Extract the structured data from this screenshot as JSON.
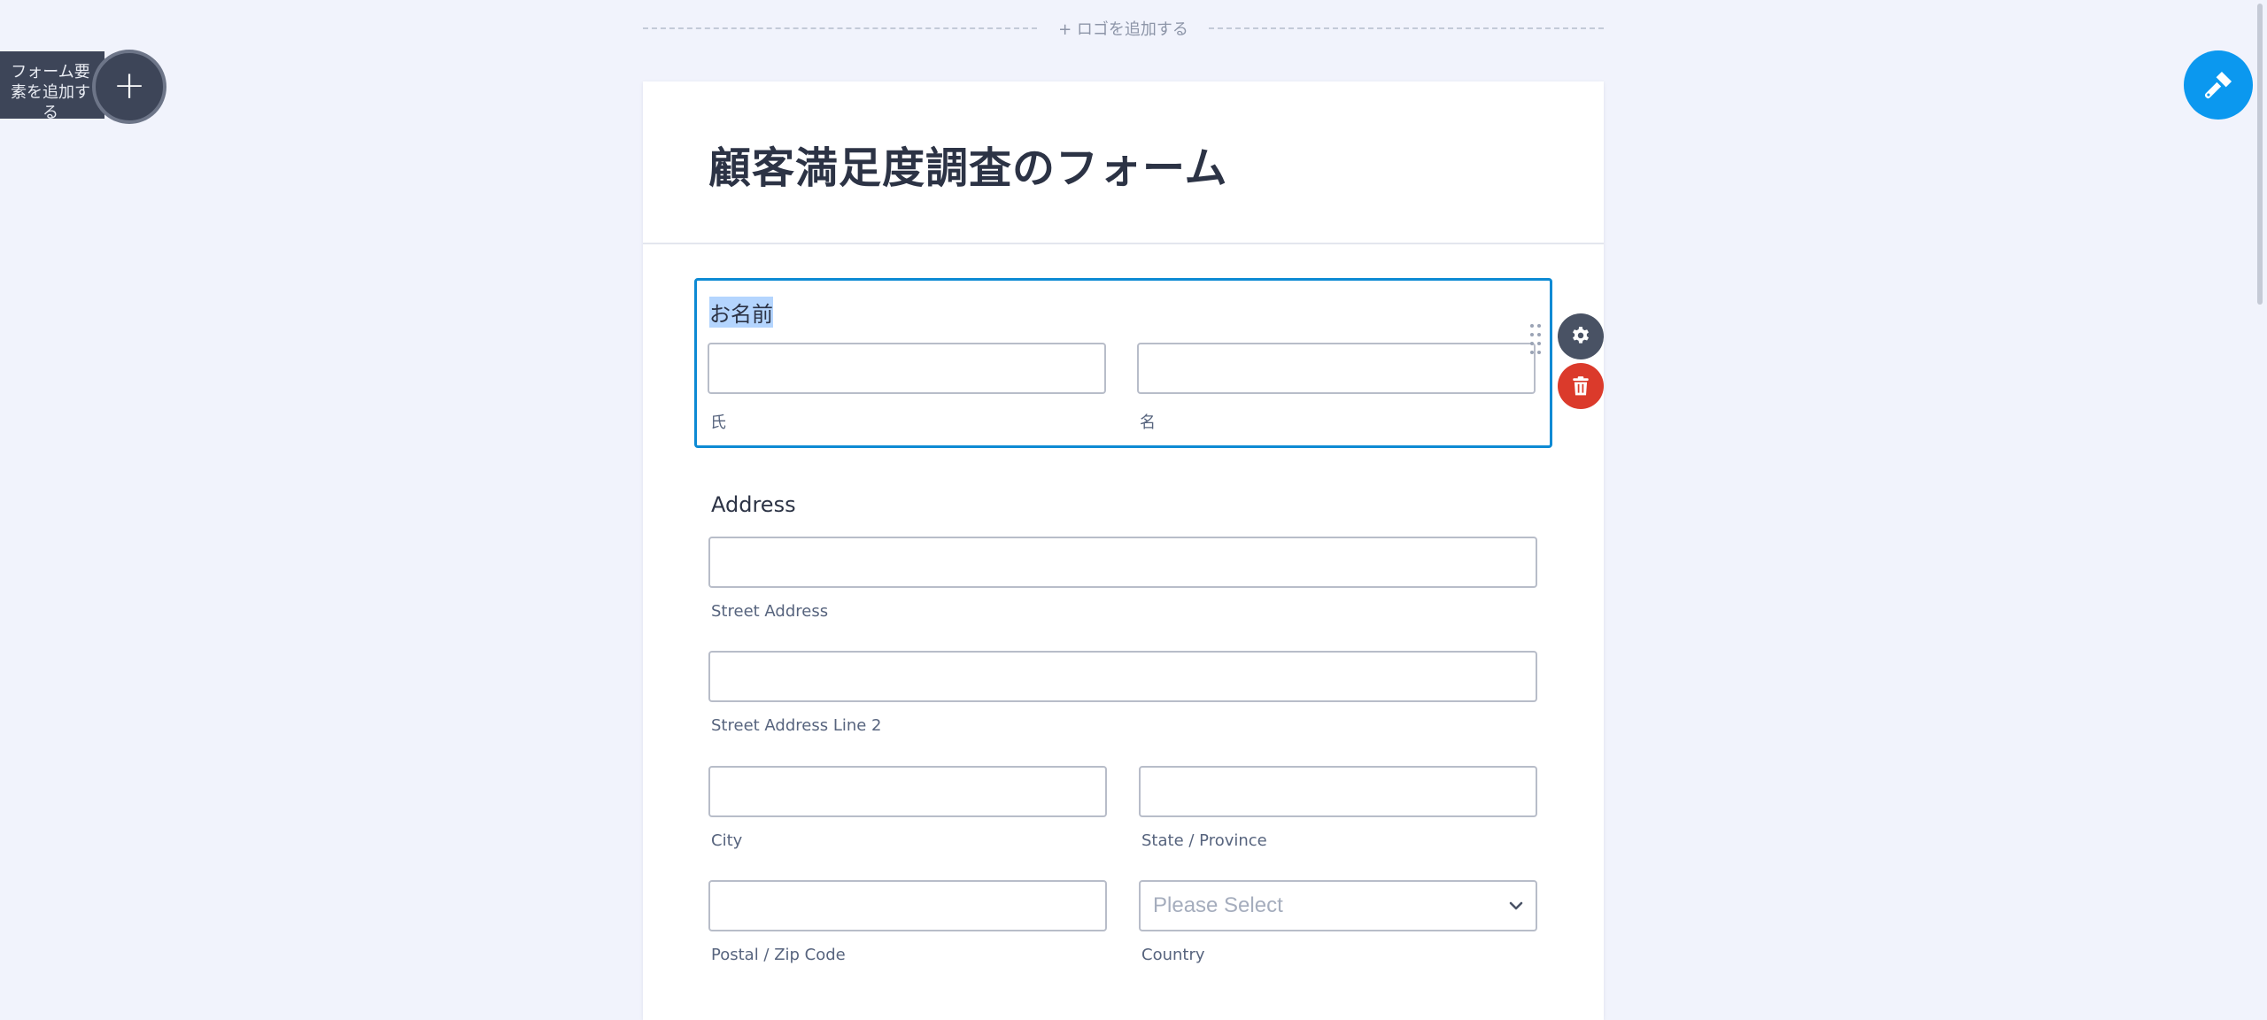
{
  "logo": {
    "add_label": "+ ロゴを追加する"
  },
  "add_element": {
    "label": "フォーム要素を追加する",
    "lines": [
      "フォーム要",
      "素を追加す",
      "る"
    ],
    "button": "+"
  },
  "form": {
    "title": "顧客満足度調査のフォーム"
  },
  "name_field": {
    "label": "お名前",
    "first_sublabel": "氏",
    "last_sublabel": "名",
    "first_value": "",
    "last_value": ""
  },
  "address_field": {
    "label": "Address",
    "street_sublabel": "Street Address",
    "street2_sublabel": "Street Address Line 2",
    "city_sublabel": "City",
    "state_sublabel": "State / Province",
    "postal_sublabel": "Postal / Zip Code",
    "country_sublabel": "Country",
    "country_placeholder": "Please Select"
  },
  "icons": {
    "add": "plus-icon",
    "designer": "paint-roller-icon",
    "settings": "gear-icon",
    "delete": "trash-icon",
    "drag": "drag-handle-icon",
    "dropdown": "chevron-down-icon"
  },
  "colors": {
    "background": "#f1f3fc",
    "selection_border": "#0d8ad4",
    "delete": "#db3a2b",
    "designer": "#0b98ef",
    "dark": "#3d4558"
  }
}
